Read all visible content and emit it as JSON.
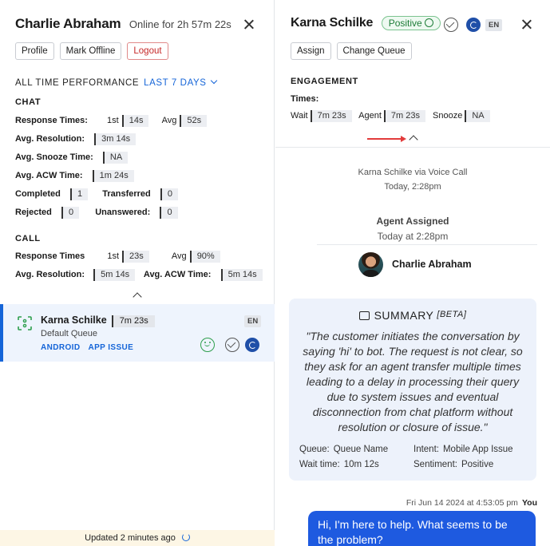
{
  "left": {
    "agent_name": "Charlie Abraham",
    "online_status": "Online for 2h 57m 22s",
    "buttons": {
      "profile": "Profile",
      "mark_offline": "Mark Offline",
      "logout": "Logout"
    },
    "performance_title": "ALL TIME PERFORMANCE",
    "performance_range": "LAST 7 DAYS",
    "chat": {
      "title": "CHAT",
      "response_times_label": "Response Times:",
      "first_label": "1st",
      "first_value": "14s",
      "avg_label": "Avg",
      "avg_value": "52s",
      "avg_resolution_label": "Avg. Resolution:",
      "avg_resolution_value": "3m 14s",
      "avg_snooze_label": "Avg. Snooze Time:",
      "avg_snooze_value": "NA",
      "avg_acw_label": "Avg. ACW Time:",
      "avg_acw_value": "1m 24s",
      "completed_label": "Completed",
      "completed_value": "1",
      "transferred_label": "Transferred",
      "transferred_value": "0",
      "rejected_label": "Rejected",
      "rejected_value": "0",
      "unanswered_label": "Unanswered:",
      "unanswered_value": "0"
    },
    "call": {
      "title": "CALL",
      "response_times_label": "Response Times",
      "first_label": "1st",
      "first_value": "23s",
      "avg_label": "Avg",
      "avg_value": "90%",
      "avg_resolution_label": "Avg. Resolution:",
      "avg_resolution_value": "5m 14s",
      "avg_acw_label": "Avg. ACW Time:",
      "avg_acw_value": "5m 14s"
    },
    "conversation": {
      "name": "Karna Schilke",
      "duration": "7m 23s",
      "queue": "Default Queue",
      "tags": [
        "ANDROID",
        "APP ISSUE"
      ],
      "language": "EN"
    },
    "updated": "Updated 2 minutes ago"
  },
  "right": {
    "customer_name": "Karna Schilke",
    "sentiment": "Positive",
    "language": "EN",
    "buttons": {
      "assign": "Assign",
      "change_queue": "Change Queue"
    },
    "engagement_title": "ENGAGEMENT",
    "times_label": "Times:",
    "wait_label": "Wait",
    "wait_value": "7m 23s",
    "agent_label": "Agent",
    "agent_value": "7m 23s",
    "snooze_label": "Snooze",
    "snooze_value": "NA",
    "via_line": "Karna Schilke via Voice Call",
    "via_time": "Today, 2:28pm",
    "assigned_title": "Agent Assigned",
    "assigned_time": "Today at 2:28pm",
    "assigned_agent": "Charlie Abraham",
    "summary": {
      "title": "SUMMARY",
      "beta": "[BETA]",
      "text": "\"The customer initiates the conversation by saying 'hi' to bot. The request is not clear, so they ask for an agent transfer multiple times leading to a delay in processing their query due to system issues and eventual disconnection from chat platform without resolution or closure of issue.\"",
      "queue_label": "Queue:",
      "queue_value": "Queue Name",
      "intent_label": "Intent:",
      "intent_value": "Mobile App Issue",
      "wait_label": "Wait time:",
      "wait_value": "10m 12s",
      "sentiment_label": "Sentiment:",
      "sentiment_value": "Positive"
    },
    "message": {
      "timestamp": "Fri Jun 14 2024 at 4:53:05 pm",
      "sender": "You",
      "text": "Hi, I'm here to help. What seems to be the problem?"
    }
  }
}
